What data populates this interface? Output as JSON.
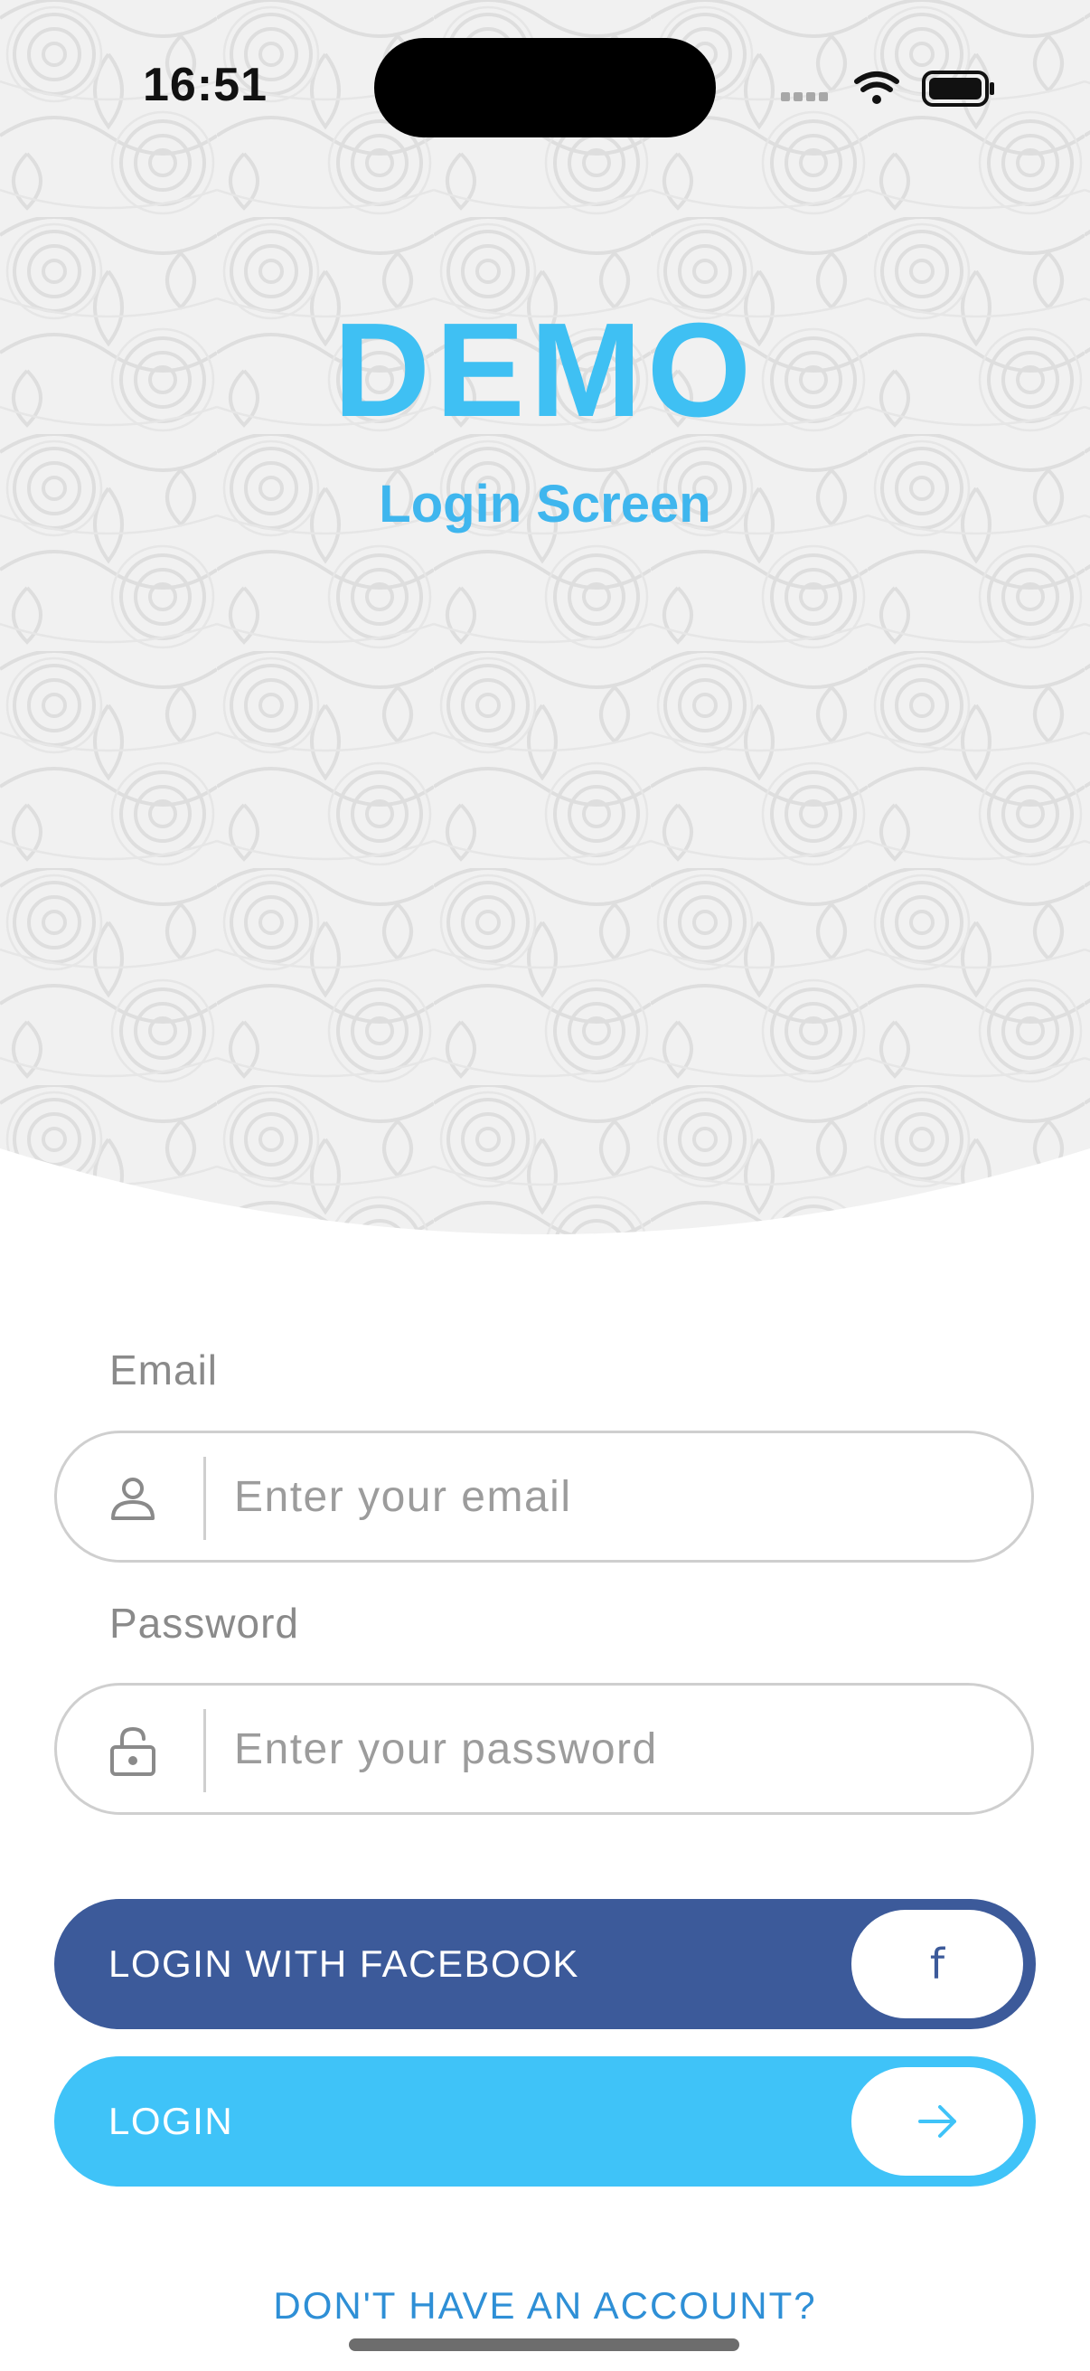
{
  "status_bar": {
    "time": "16:51"
  },
  "header": {
    "title": "DEMO",
    "subtitle": "Login Screen"
  },
  "form": {
    "email": {
      "label": "Email",
      "placeholder": "Enter your email",
      "value": "",
      "icon": "person-icon"
    },
    "password": {
      "label": "Password",
      "placeholder": "Enter your password",
      "value": "",
      "icon": "lock-icon"
    }
  },
  "buttons": {
    "facebook_label": "LOGIN WITH FACEBOOK",
    "facebook_icon_glyph": "f",
    "login_label": "LOGIN",
    "login_icon": "arrow-right-icon"
  },
  "footer": {
    "signup_link": "DON'T HAVE AN ACCOUNT?"
  },
  "colors": {
    "accent": "#3fc0f3",
    "facebook": "#3c5a9a",
    "link": "#2e8fd6",
    "placeholder": "#9c9c9c"
  }
}
